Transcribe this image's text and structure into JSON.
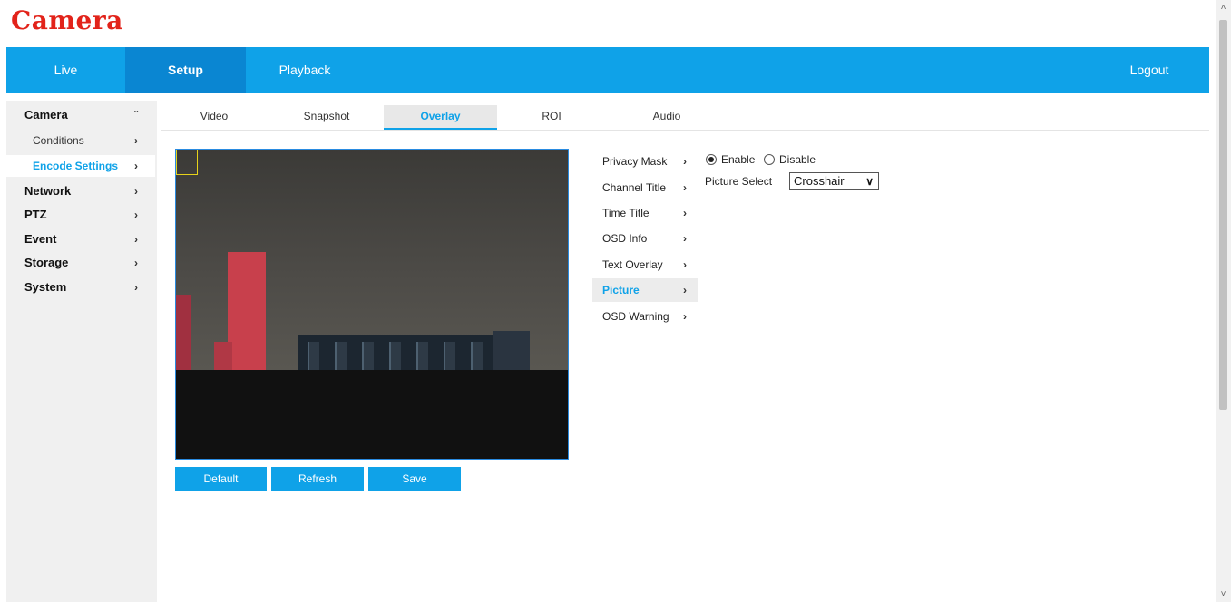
{
  "brand": "Camera",
  "topnav": {
    "live": "Live",
    "setup": "Setup",
    "playback": "Playback",
    "logout": "Logout"
  },
  "sidebar": {
    "chevron": "›",
    "camera": "Camera",
    "camera_expand": "ˇ",
    "conditions": "Conditions",
    "encode_settings": "Encode Settings",
    "network": "Network",
    "ptz": "PTZ",
    "event": "Event",
    "storage": "Storage",
    "system": "System"
  },
  "tabs": {
    "video": "Video",
    "snapshot": "Snapshot",
    "overlay": "Overlay",
    "roi": "ROI",
    "audio": "Audio"
  },
  "buttons": {
    "default": "Default",
    "refresh": "Refresh",
    "save": "Save"
  },
  "overlay_menu": {
    "privacy_mask": "Privacy Mask",
    "channel_title": "Channel Title",
    "time_title": "Time Title",
    "osd_info": "OSD Info",
    "text_overlay": "Text Overlay",
    "picture": "Picture",
    "osd_warning": "OSD Warning"
  },
  "picture_settings": {
    "enable": "Enable",
    "disable": "Disable",
    "selected": "enable",
    "picture_select_label": "Picture Select",
    "picture_select_value": "Crosshair"
  },
  "colors": {
    "accent": "#0fa2e8",
    "brand": "#e2231a"
  }
}
